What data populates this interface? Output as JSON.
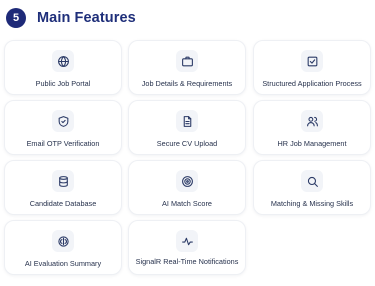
{
  "section": {
    "number": "5",
    "title": "Main Features"
  },
  "features": [
    {
      "label": "Public Job Portal",
      "icon": "globe-icon"
    },
    {
      "label": "Job Details & Requirements",
      "icon": "briefcase-icon"
    },
    {
      "label": "Structured Application Process",
      "icon": "checklist-icon"
    },
    {
      "label": "Email OTP Verification",
      "icon": "shield-icon"
    },
    {
      "label": "Secure CV Upload",
      "icon": "document-icon"
    },
    {
      "label": "HR Job Management",
      "icon": "users-icon"
    },
    {
      "label": "Candidate Database",
      "icon": "database-icon"
    },
    {
      "label": "AI Match Score",
      "icon": "target-icon"
    },
    {
      "label": "Matching & Missing Skills",
      "icon": "search-icon"
    },
    {
      "label": "AI Evaluation Summary",
      "icon": "brain-icon"
    },
    {
      "label": "SignalR Real-Time Notifications",
      "icon": "activity-icon"
    }
  ]
}
